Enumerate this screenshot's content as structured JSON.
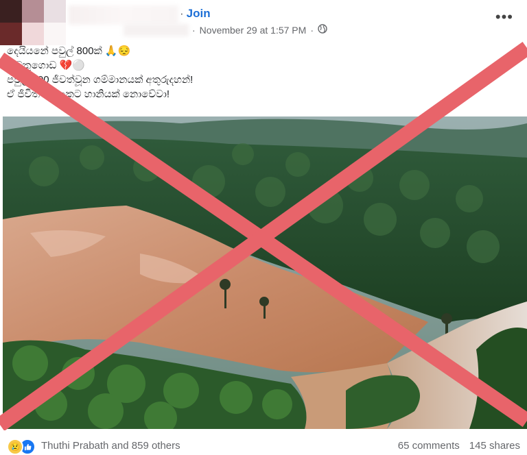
{
  "header": {
    "join_label": "Join",
    "separator": "·",
    "timestamp": "November 29 at 1:57 PM",
    "meta_separator": "·",
    "audience_icon": "globe-icon",
    "more_label": "•••"
  },
  "caption": {
    "lines": [
      "දෙයියනේ පවුල් 800ක් 🙏😔",
      "...වතුගොඩ 💔⚪",
      "පවුල් 800 ජීවත්වූන ගම්මානයක් අතුරුදහන්!",
      "ඒ ජීවිත සියලුකට හානියක් නොවේවා!"
    ]
  },
  "image": {
    "description_icon": "landslide-photo",
    "overlay": "red-x-mark",
    "overlay_color": "#e8646a"
  },
  "footer": {
    "reactions": [
      "sad",
      "like"
    ],
    "reaction_text": "Thuthi Prabath and 859 others",
    "comments": "65 comments",
    "shares": "145 shares"
  },
  "colors": {
    "accent": "#1d6fd6",
    "muted": "#65676b",
    "text": "#1c1e21"
  }
}
